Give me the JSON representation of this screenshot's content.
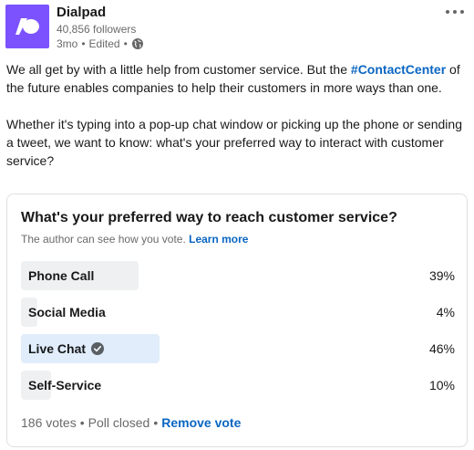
{
  "colors": {
    "brand": "#7c52ff",
    "link": "#0a66c2",
    "option_bar": "#eef0f2",
    "selected_bar": "#e1edfb"
  },
  "author": {
    "name": "Dialpad",
    "followers": "40,856 followers",
    "time": "3mo",
    "dot": "•",
    "edited": "Edited",
    "visibility_icon": "globe-icon",
    "logo_icon": "dialpad-logo-icon"
  },
  "more_icon": "more-horizontal-icon",
  "post": {
    "p1_before": "We all get by with a little help from customer service. But the ",
    "p1_hashtag": "#ContactCenter",
    "p1_after": " of the future enables companies to help their customers in more ways than one.",
    "p2": "Whether it's typing into a pop-up chat window or picking up the phone or sending a tweet, we want to know: what's your preferred way to interact with customer service?"
  },
  "poll": {
    "question": "What's your preferred way to reach customer service?",
    "note": "The author can see how you vote.",
    "learn_more": "Learn more",
    "options": [
      {
        "label": "Phone Call",
        "percent_text": "39%",
        "percent": 39,
        "selected": false
      },
      {
        "label": "Social Media",
        "percent_text": "4%",
        "percent": 4,
        "selected": false
      },
      {
        "label": "Live Chat",
        "percent_text": "46%",
        "percent": 46,
        "selected": true
      },
      {
        "label": "Self-Service",
        "percent_text": "10%",
        "percent": 10,
        "selected": false
      }
    ],
    "votes": "186 votes",
    "status": "Poll closed",
    "dot": "•",
    "remove_vote": "Remove vote"
  }
}
